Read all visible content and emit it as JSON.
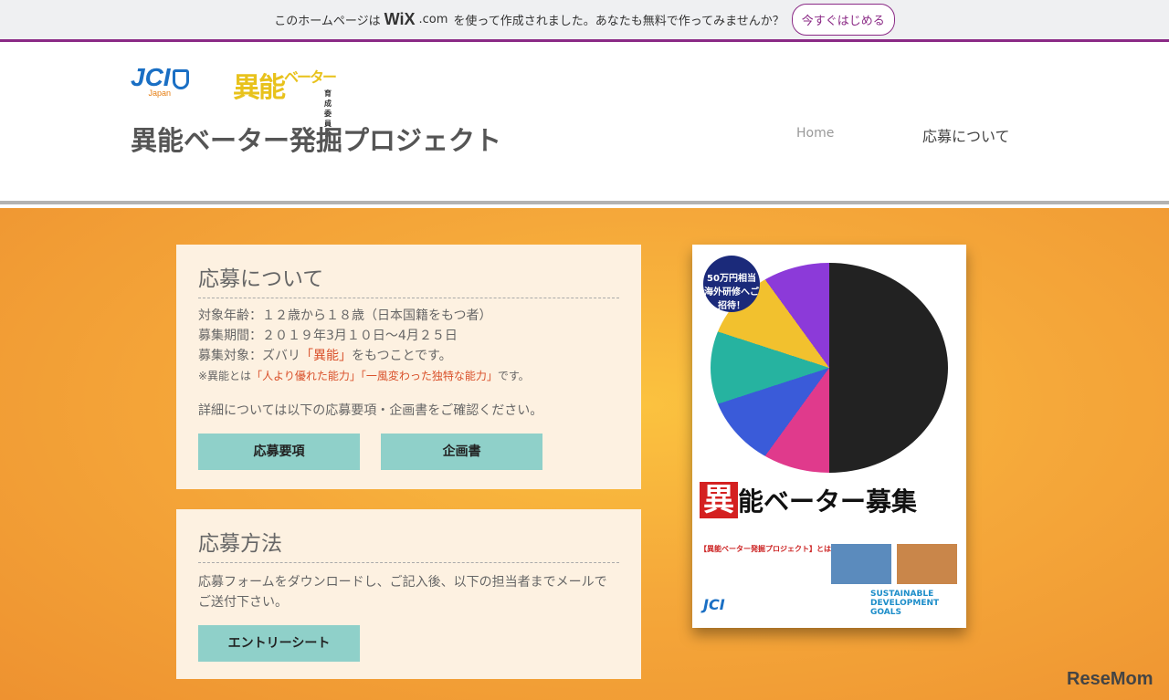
{
  "wix_banner": {
    "text_before": "このホームページは",
    "brand": "WiX",
    ".com": ".com",
    "text_after": "を使って作成されました。あなたも無料で作ってみませんか？",
    "cta": "今すぐはじめる"
  },
  "header": {
    "logo_jci": "JCI",
    "logo_jci_sub": "Japan",
    "logo_inou": "異能",
    "logo_beta": "ベーター",
    "logo_committee": "育成委員会",
    "site_title": "異能ベーター発掘プロジェクト",
    "nav": [
      {
        "label": "Home"
      },
      {
        "label": "応募について"
      }
    ]
  },
  "about": {
    "title": "応募について",
    "age": "対象年齢：１２歳から１８歳（日本国籍をもつ者）",
    "period": "募集期間：２０１９年3月１０日～4月２５日",
    "target_prefix": "募集対象：ズバリ",
    "target_highlight": "「異能」",
    "target_suffix": "をもつことです。",
    "note_prefix": "※異能とは",
    "note_highlight1": "「人より優れた能力」",
    "note_highlight2": "「一風変わった独特な能力」",
    "note_suffix": "です。",
    "details": "詳細については以下の応募要項・企画書をご確認ください。",
    "buttons": [
      "応募要項",
      "企画書"
    ]
  },
  "method": {
    "title": "応募方法",
    "text": "応募フォームをダウンロードし、ご記入後、以下の担当者までメールでご送付下さい。",
    "button": "エントリーシート"
  },
  "poster": {
    "badge": "50万円相当 海外研修へご招待！",
    "title_i": "異",
    "title_rest": "能ベーター募集",
    "subtitle": "【異能ベーター発掘プロジェクト】とは",
    "sdg": "SUSTAINABLE DEVELOPMENT GOALS",
    "jci": "JCI"
  },
  "watermark": "ReseMom"
}
